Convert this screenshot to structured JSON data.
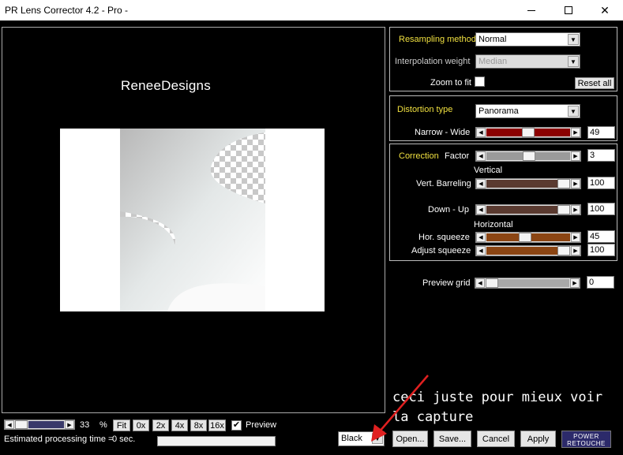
{
  "window": {
    "title": "PR Lens Corrector 4.2 - Pro -"
  },
  "preview": {
    "watermark": "ReneeDesigns"
  },
  "resampling": {
    "method_label": "Resampling method",
    "method_value": "Normal",
    "interp_label": "Interpolation weight",
    "interp_value": "Median",
    "zoom_to_fit_label": "Zoom to fit",
    "zoom_to_fit_checked": false,
    "reset_label": "Reset all"
  },
  "distortion": {
    "type_label": "Distortion type",
    "type_value": "Panorama",
    "narrow_wide_label": "Narrow - Wide",
    "narrow_wide_value": "49",
    "narrow_wide_fraction": 0.49,
    "narrow_wide_color": "#8b0000"
  },
  "correction": {
    "section_label": "Correction",
    "factor_label": "Factor",
    "factor_value": "3",
    "factor_fraction": 0.5,
    "vertical_label": "Vertical",
    "vert_barreling_label": "Vert. Barreling",
    "vert_barreling_value": "100",
    "down_up_label": "Down - Up",
    "down_up_value": "100",
    "vertical_color": "#5a3a30",
    "horizontal_label": "Horizontal",
    "hor_squeeze_label": "Hor. squeeze",
    "hor_squeeze_value": "45",
    "hor_squeeze_fraction": 0.45,
    "adjust_squeeze_label": "Adjust squeeze",
    "adjust_squeeze_value": "100",
    "horizontal_color": "#8b4513"
  },
  "preview_grid": {
    "label": "Preview grid",
    "value": "0"
  },
  "bottom": {
    "zoom_value": "33",
    "zoom_unit": "%",
    "zoom_buttons": [
      "Fit",
      "0x",
      "2x",
      "4x",
      "8x",
      "16x"
    ],
    "preview_label": "Preview",
    "preview_checked": true,
    "estimated_label": "Estimated processing time =",
    "estimated_value": "0 sec.",
    "background_value": "Black",
    "open_label": "Open...",
    "save_label": "Save...",
    "cancel_label": "Cancel",
    "apply_label": "Apply",
    "logo_line1": "POWER",
    "logo_line2": "RETOUCHE"
  },
  "annotation": {
    "text": "ceci juste pour mieux voir la capture",
    "arrow_color": "#e02020"
  },
  "icons": [
    "minimize-icon",
    "maximize-icon",
    "close-icon",
    "chevron-down-icon",
    "arrow-left-icon",
    "arrow-right-icon",
    "checkmark-icon",
    "red-arrow-icon"
  ]
}
